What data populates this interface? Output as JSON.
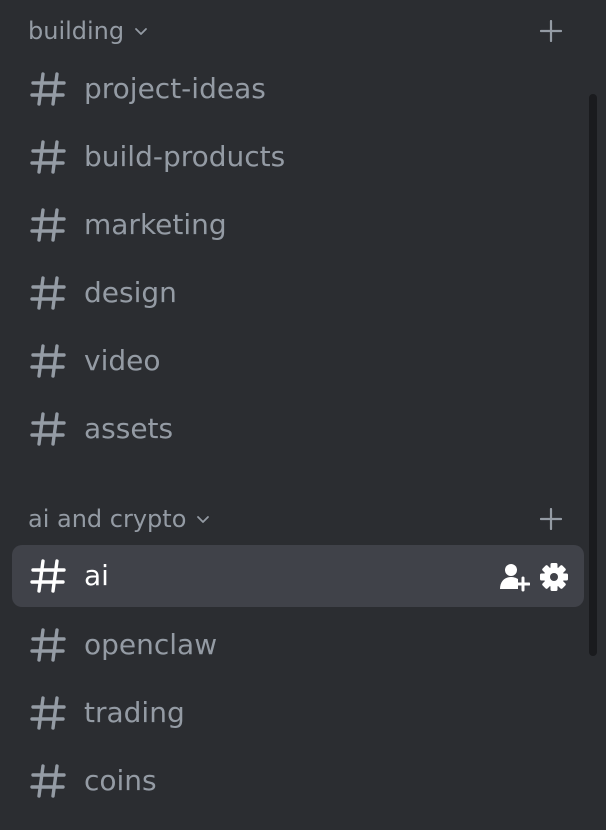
{
  "categories": [
    {
      "label": "building",
      "channels": [
        "project-ideas",
        "build-products",
        "marketing",
        "design",
        "video",
        "assets"
      ]
    },
    {
      "label": "ai and crypto",
      "channels": [
        "ai",
        "openclaw",
        "trading",
        "coins"
      ]
    }
  ],
  "active_channel": "ai",
  "icons": {
    "category_toggle": "chevron-down-icon",
    "category_add": "plus-icon",
    "channel": "hash-icon",
    "invite": "add-user-icon",
    "settings": "gear-icon"
  },
  "colors": {
    "background": "#2b2d31",
    "active_row": "#404249",
    "muted_text": "#949ba4",
    "active_text": "#ffffff"
  }
}
